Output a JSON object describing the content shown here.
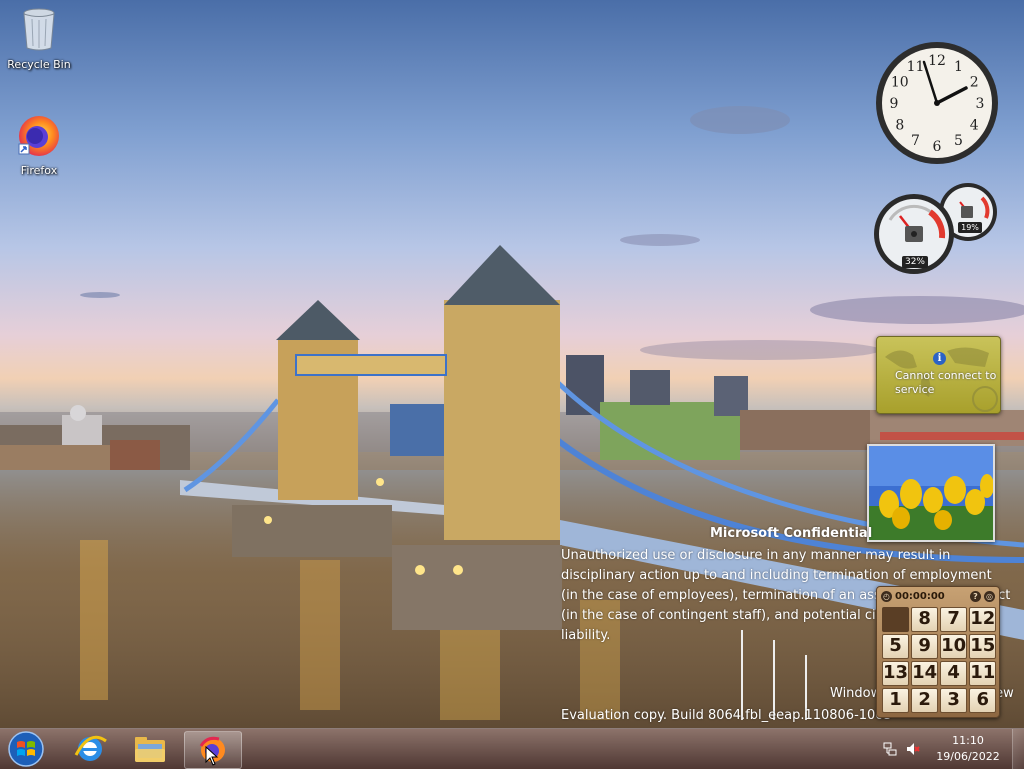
{
  "desktop": {
    "icons": [
      {
        "label": "Recycle Bin",
        "icon": "recycle-bin-icon"
      },
      {
        "label": "Firefox",
        "icon": "firefox-icon"
      }
    ]
  },
  "gadgets": {
    "clock": {
      "time": "11:10",
      "numerals": [
        "12",
        "1",
        "2",
        "3",
        "4",
        "5",
        "6",
        "7",
        "8",
        "9",
        "10",
        "11"
      ]
    },
    "cpu_meter": {
      "cpu_label": "32%",
      "memory_label": "19%",
      "cpu": 0.32,
      "memory": 0.19
    },
    "weather": {
      "message": "Cannot connect to service",
      "info_glyph": "i"
    },
    "puzzle": {
      "timer": "00:00:00",
      "tiles": [
        [
          "",
          "8",
          "7",
          "12"
        ],
        [
          "5",
          "9",
          "10",
          "15"
        ],
        [
          "13",
          "14",
          "4",
          "11"
        ],
        [
          "1",
          "2",
          "3",
          "6"
        ]
      ]
    }
  },
  "watermark": {
    "title": "Microsoft Confidential",
    "body": "Unauthorized use or disclosure in any manner may result in disciplinary action up to and including termination of employment (in the case of employees), termination of an assignment or contract (in the case of contingent staff), and potential civil or criminal liability.",
    "edition": "Windows Developer Preview",
    "build": "Evaluation copy. Build 8064.fbl_eeap.110806-1005"
  },
  "taskbar": {
    "pinned": [
      {
        "name": "start-button",
        "icon": "windows-logo-icon"
      },
      {
        "name": "internet-explorer-button",
        "icon": "ie-icon"
      },
      {
        "name": "file-explorer-button",
        "icon": "folder-icon"
      },
      {
        "name": "firefox-taskbar-button",
        "icon": "firefox-icon",
        "active": true
      }
    ],
    "tray": {
      "network": "network-icon",
      "volume": "volume-muted-icon"
    },
    "clock": {
      "time": "11:10",
      "date": "19/06/2022"
    }
  }
}
